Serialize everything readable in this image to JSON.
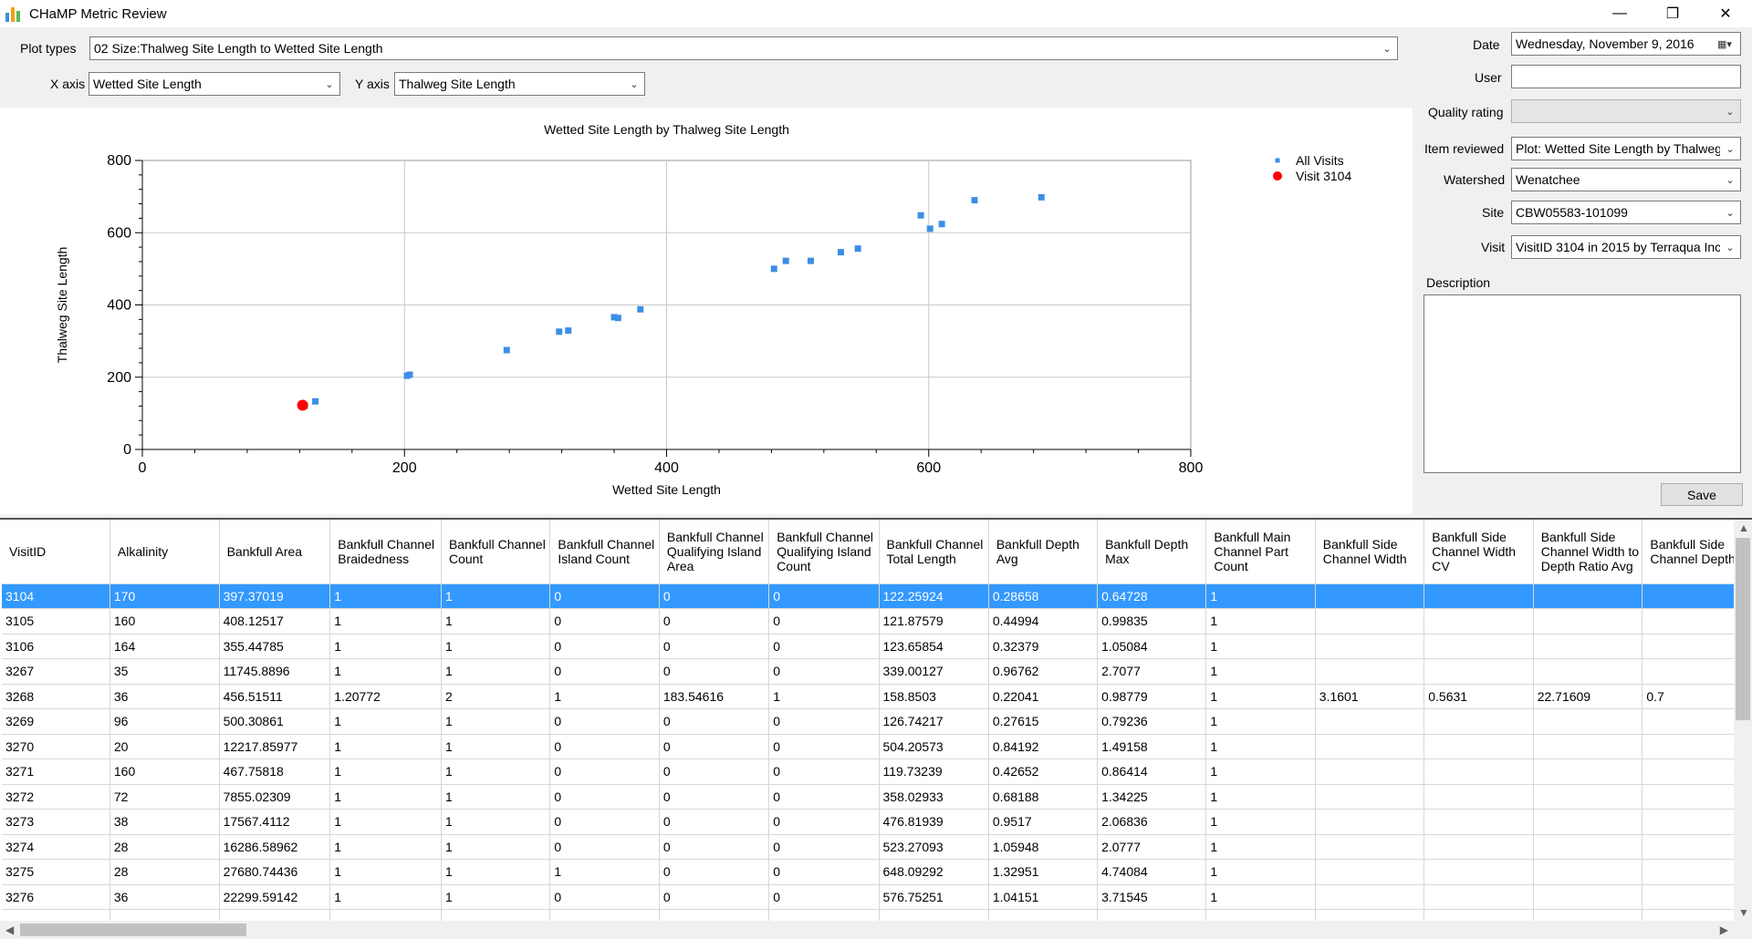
{
  "window": {
    "title": "CHaMP Metric Review",
    "minimize": "—",
    "restore": "❐",
    "close": "✕"
  },
  "controls": {
    "plot_types_label": "Plot types",
    "plot_types_value": "02 Size:Thalweg Site Length to Wetted Site Length",
    "x_axis_label": "X axis",
    "x_axis_value": "Wetted Site Length",
    "y_axis_label": "Y axis",
    "y_axis_value": "Thalweg Site Length"
  },
  "review": {
    "date_label": "Date",
    "date_value": "Wednesday,  November   9, 2016",
    "user_label": "User",
    "user_value": "",
    "quality_label": "Quality rating",
    "quality_value": "",
    "item_label": "Item reviewed",
    "item_value": "Plot: Wetted Site Length by Thalweg",
    "watershed_label": "Watershed",
    "watershed_value": "Wenatchee",
    "site_label": "Site",
    "site_value": "CBW05583-101099",
    "visit_label": "Visit",
    "visit_value": "VisitID 3104 in 2015 by Terraqua Inc.",
    "description_label": "Description",
    "save_label": "Save"
  },
  "chart_data": {
    "type": "scatter",
    "title": "Wetted Site Length by Thalweg Site Length",
    "xlabel": "Wetted Site Length",
    "ylabel": "Thalweg Site Length",
    "xlim": [
      0,
      800
    ],
    "ylim": [
      0,
      800
    ],
    "xticks": [
      0,
      200,
      400,
      600,
      800
    ],
    "yticks": [
      0,
      200,
      400,
      600,
      800
    ],
    "grid": true,
    "legend_position": "top-right",
    "series": [
      {
        "name": "All Visits",
        "color": "#3c8ee6",
        "marker": "square",
        "points": [
          [
            122,
            124
          ],
          [
            124,
            121
          ],
          [
            132,
            133
          ],
          [
            202,
            204
          ],
          [
            204,
            207
          ],
          [
            278,
            275
          ],
          [
            318,
            326
          ],
          [
            325,
            329
          ],
          [
            360,
            366
          ],
          [
            363,
            364
          ],
          [
            380,
            388
          ],
          [
            482,
            500
          ],
          [
            491,
            522
          ],
          [
            510,
            522
          ],
          [
            533,
            546
          ],
          [
            546,
            556
          ],
          [
            594,
            648
          ],
          [
            601,
            611
          ],
          [
            610,
            624
          ],
          [
            635,
            690
          ],
          [
            686,
            698
          ]
        ]
      },
      {
        "name": "Visit 3104",
        "color": "#ff0000",
        "marker": "circle",
        "points": [
          [
            122.26,
            122.26
          ]
        ]
      }
    ]
  },
  "table": {
    "columns": [
      "VisitID",
      "Alkalinity",
      "Bankfull Area",
      "Bankfull Channel Braidedness",
      "Bankfull Channel Count",
      "Bankfull Channel Island Count",
      "Bankfull Channel Qualifying Island Area",
      "Bankfull Channel Qualifying Island Count",
      "Bankfull Channel Total Length",
      "Bankfull Depth Avg",
      "Bankfull Depth Max",
      "Bankfull Main Channel Part Count",
      "Bankfull Side Channel Width",
      "Bankfull Side Channel Width CV",
      "Bankfull Side Channel Width to Depth Ratio Avg",
      "Bankfull Side Channel Depth"
    ],
    "selected_row": 0,
    "rows": [
      [
        "3104",
        "170",
        "397.37019",
        "1",
        "1",
        "0",
        "0",
        "0",
        "122.25924",
        "0.28658",
        "0.64728",
        "1",
        "",
        "",
        "",
        ""
      ],
      [
        "3105",
        "160",
        "408.12517",
        "1",
        "1",
        "0",
        "0",
        "0",
        "121.87579",
        "0.44994",
        "0.99835",
        "1",
        "",
        "",
        "",
        ""
      ],
      [
        "3106",
        "164",
        "355.44785",
        "1",
        "1",
        "0",
        "0",
        "0",
        "123.65854",
        "0.32379",
        "1.05084",
        "1",
        "",
        "",
        "",
        ""
      ],
      [
        "3267",
        "35",
        "11745.8896",
        "1",
        "1",
        "0",
        "0",
        "0",
        "339.00127",
        "0.96762",
        "2.7077",
        "1",
        "",
        "",
        "",
        ""
      ],
      [
        "3268",
        "36",
        "456.51511",
        "1.20772",
        "2",
        "1",
        "183.54616",
        "1",
        "158.8503",
        "0.22041",
        "0.98779",
        "1",
        "3.1601",
        "0.5631",
        "22.71609",
        "0.7"
      ],
      [
        "3269",
        "96",
        "500.30861",
        "1",
        "1",
        "0",
        "0",
        "0",
        "126.74217",
        "0.27615",
        "0.79236",
        "1",
        "",
        "",
        "",
        ""
      ],
      [
        "3270",
        "20",
        "12217.85977",
        "1",
        "1",
        "0",
        "0",
        "0",
        "504.20573",
        "0.84192",
        "1.49158",
        "1",
        "",
        "",
        "",
        ""
      ],
      [
        "3271",
        "160",
        "467.75818",
        "1",
        "1",
        "0",
        "0",
        "0",
        "119.73239",
        "0.42652",
        "0.86414",
        "1",
        "",
        "",
        "",
        ""
      ],
      [
        "3272",
        "72",
        "7855.02309",
        "1",
        "1",
        "0",
        "0",
        "0",
        "358.02933",
        "0.68188",
        "1.34225",
        "1",
        "",
        "",
        "",
        ""
      ],
      [
        "3273",
        "38",
        "17567.4112",
        "1",
        "1",
        "0",
        "0",
        "0",
        "476.81939",
        "0.9517",
        "2.06836",
        "1",
        "",
        "",
        "",
        ""
      ],
      [
        "3274",
        "28",
        "16286.58962",
        "1",
        "1",
        "0",
        "0",
        "0",
        "523.27093",
        "1.05948",
        "2.0777",
        "1",
        "",
        "",
        "",
        ""
      ],
      [
        "3275",
        "28",
        "27680.74436",
        "1",
        "1",
        "1",
        "0",
        "0",
        "648.09292",
        "1.32951",
        "4.74084",
        "1",
        "",
        "",
        "",
        ""
      ],
      [
        "3276",
        "36",
        "22299.59142",
        "1",
        "1",
        "0",
        "0",
        "0",
        "576.75251",
        "1.04151",
        "3.71545",
        "1",
        "",
        "",
        "",
        ""
      ],
      [
        "",
        "",
        "",
        "",
        "",
        "",
        "",
        "",
        "",
        "",
        "",
        "",
        "",
        "",
        "",
        ""
      ]
    ]
  }
}
